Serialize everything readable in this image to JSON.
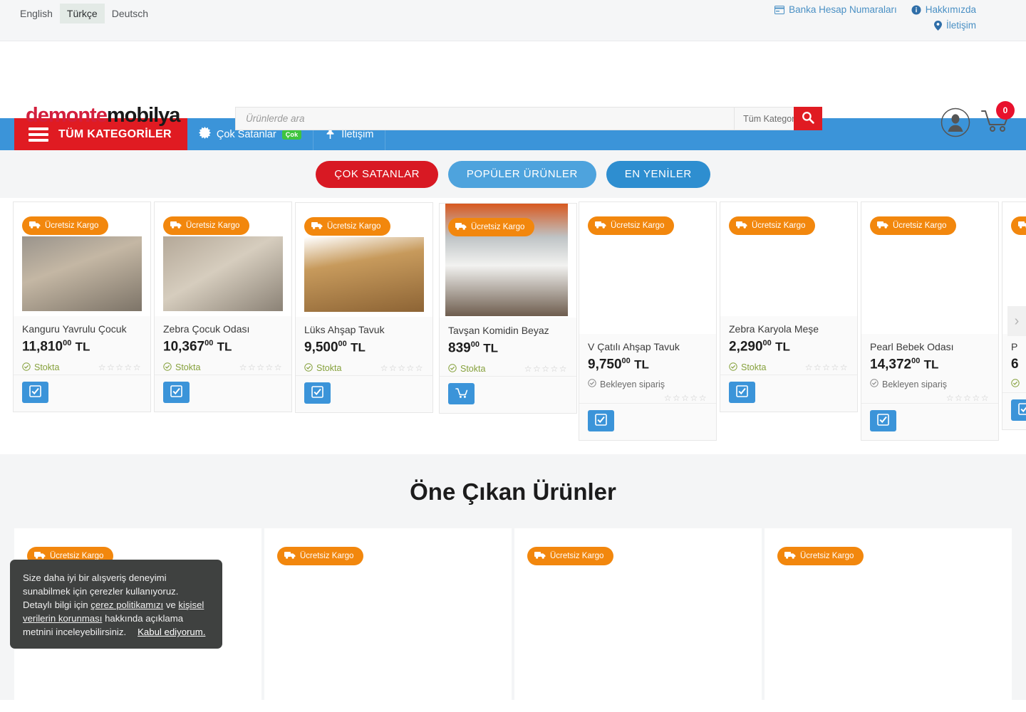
{
  "topbar": {
    "languages": [
      {
        "label": "English",
        "active": false
      },
      {
        "label": "Türkçe",
        "active": true
      },
      {
        "label": "Deutsch",
        "active": false
      }
    ],
    "links_row1": [
      {
        "label": "Banka Hesap Numaraları",
        "icon": "bank-card-icon"
      },
      {
        "label": "Hakkımızda",
        "icon": "info-icon"
      }
    ],
    "links_row2": [
      {
        "label": "İletişim",
        "icon": "location-pin-icon"
      }
    ],
    "link_color": "#4a90c4"
  },
  "header": {
    "logo_part1": "demonte",
    "logo_part2": "mobilya",
    "logo_color1": "#d31f3c",
    "logo_color2": "#1a1a1a",
    "search": {
      "value": "",
      "placeholder": "Ürünlerde ara",
      "category_label": "Tüm Kategoriler",
      "button_icon": "search-icon",
      "button_color": "#e01b22"
    },
    "account_icon": "user-account-icon",
    "cart_icon": "shopping-cart-icon",
    "cart_count": "0",
    "cart_badge_color": "#e8112d"
  },
  "nav": {
    "all_categories_label": "TÜM KATEGORİLER",
    "all_categories_color": "#e01b22",
    "bar_color": "#3b94d9",
    "items": [
      {
        "label": "Çok Satanlar",
        "icon": "burst-star-icon",
        "badge": "Çok"
      },
      {
        "label": "İletişim",
        "icon": "pin-icon",
        "badge": ""
      }
    ]
  },
  "tabs": [
    {
      "label": "ÇOK SATANLAR",
      "style": "red",
      "active": true
    },
    {
      "label": "POPÜLER ÜRÜNLER",
      "style": "lightblue",
      "active": false
    },
    {
      "label": "EN YENİLER",
      "style": "blue",
      "active": false
    }
  ],
  "carousel": {
    "freeship_label": "Ücretsiz Kargo",
    "freeship_icon": "truck-icon",
    "freeship_color": "#f2870d",
    "next_arrow_icon": "chevron-right-icon",
    "stars_empty": "☆☆☆☆☆",
    "products": [
      {
        "title": "Kanguru Yavrulu Çocuk",
        "price_main": "11,810",
        "price_cents": "00",
        "currency": "TL",
        "stock": "Stokta",
        "stock_state": "in",
        "action_icon": "checkbox-check-icon",
        "has_image": true,
        "image_tone": "#8f8379"
      },
      {
        "title": "Zebra Çocuk Odası",
        "price_main": "10,367",
        "price_cents": "00",
        "currency": "TL",
        "stock": "Stokta",
        "stock_state": "in",
        "action_icon": "checkbox-check-icon",
        "has_image": true,
        "image_tone": "#9b8f86"
      },
      {
        "title": "Lüks Ahşap Tavuk",
        "price_main": "9,500",
        "price_cents": "00",
        "currency": "TL",
        "stock": "Stokta",
        "stock_state": "in",
        "action_icon": "checkbox-check-icon",
        "has_image": true,
        "image_tone": "#b08b52"
      },
      {
        "title": "Tavşan Komidin Beyaz",
        "price_main": "839",
        "price_cents": "00",
        "currency": "TL",
        "stock": "Stokta",
        "stock_state": "in",
        "action_icon": "cart-icon",
        "has_image": true,
        "image_tone": "#7e7b76"
      },
      {
        "title": "V Çatılı Ahşap Tavuk",
        "price_main": "9,750",
        "price_cents": "00",
        "currency": "TL",
        "stock": "Bekleyen sipariş",
        "stock_state": "pending",
        "action_icon": "checkbox-check-icon",
        "has_image": false,
        "image_tone": ""
      },
      {
        "title": "Zebra Karyola Meşe",
        "price_main": "2,290",
        "price_cents": "00",
        "currency": "TL",
        "stock": "Stokta",
        "stock_state": "in",
        "action_icon": "checkbox-check-icon",
        "has_image": false,
        "image_tone": ""
      },
      {
        "title": "Pearl Bebek Odası",
        "price_main": "14,372",
        "price_cents": "00",
        "currency": "TL",
        "stock": "Bekleyen sipariş",
        "stock_state": "pending",
        "action_icon": "checkbox-check-icon",
        "has_image": false,
        "image_tone": ""
      },
      {
        "title": "P",
        "price_main": "6",
        "price_cents": "",
        "currency": "",
        "stock": "",
        "stock_state": "in",
        "action_icon": "checkbox-check-icon",
        "has_image": false,
        "image_tone": ""
      }
    ]
  },
  "featured": {
    "heading": "Öne Çıkan Ürünler",
    "freeship_label": "Ücretsiz Kargo",
    "cards": [
      {
        "badge": "Ücretsiz Kargo"
      },
      {
        "badge": "Ücretsiz Kargo"
      },
      {
        "badge": "Ücretsiz Kargo"
      },
      {
        "badge": "Ücretsiz Kargo"
      }
    ]
  },
  "cookie": {
    "line1": "Size daha iyi bir alışveriş deneyimi",
    "line2": "sunabilmek için çerezler kullanıyoruz.",
    "line3_a": "Detaylı bilgi için ",
    "link1": "çerez politikamızı",
    "line3_b": " ve ",
    "link2": "kişisel verilerin korunması",
    "line3_c": " hakkında açıklama metnini inceleyebilirsiniz.",
    "accept": "Kabul ediyorum."
  }
}
